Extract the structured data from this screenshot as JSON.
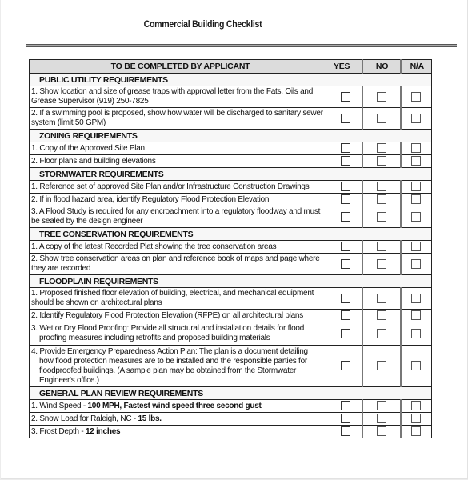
{
  "document": {
    "title": "Commercial Building Checklist"
  },
  "table": {
    "headers": {
      "description": "TO BE COMPLETED BY APPLICANT",
      "yes": "YES",
      "no": "NO",
      "na": "N/A"
    },
    "sections": [
      {
        "title": "PUBLIC UTILITY REQUIREMENTS",
        "items": [
          {
            "text": "1. Show location and size of grease traps with approval letter from the Fats, Oils and Grease Supervisor (919) 250-7825",
            "yes": false,
            "no": false,
            "na": false
          },
          {
            "text": "2. If a swimming pool is proposed, show how water will be discharged to sanitary sewer system (limit 50 GPM)",
            "yes": false,
            "no": false,
            "na": false
          }
        ]
      },
      {
        "title": "ZONING  REQUIREMENTS",
        "items": [
          {
            "text": "1. Copy of the Approved Site Plan",
            "yes": false,
            "no": false,
            "na": false
          },
          {
            "text": "2. Floor plans and building elevations",
            "yes": false,
            "no": false,
            "na": false
          }
        ]
      },
      {
        "title": "STORMWATER  REQUIREMENTS",
        "items": [
          {
            "text": "1. Reference set of approved Site Plan and/or Infrastructure Construction Drawings",
            "yes": false,
            "no": false,
            "na": false
          },
          {
            "text": "2. If in flood hazard area, identify Regulatory Flood Protection Elevation",
            "yes": false,
            "no": false,
            "na": false
          },
          {
            "text": "3. A Flood Study is required for any encroachment into a regulatory floodway and must be sealed by the design engineer",
            "yes": false,
            "no": false,
            "na": false
          }
        ]
      },
      {
        "title": "TREE CONSERVATION REQUIREMENTS",
        "items": [
          {
            "text": "1. A copy of the latest Recorded Plat showing the tree conservation areas",
            "yes": false,
            "no": false,
            "na": false
          },
          {
            "text": "2. Show tree conservation areas on plan and reference book of maps and page where they are recorded",
            "yes": false,
            "no": false,
            "na": false
          }
        ]
      },
      {
        "title": "FLOODPLAIN REQUIREMENTS",
        "items": [
          {
            "text": "1. Proposed finished floor elevation of building, electrical, and mechanical equipment should be shown on architectural plans",
            "yes": false,
            "no": false,
            "na": false
          },
          {
            "text": "2. Identify Regulatory Flood Protection Elevation (RFPE) on all architectural plans",
            "yes": false,
            "no": false,
            "na": false
          },
          {
            "text_first": "3. Wet or Dry Flood Proofing:  Provide all structural and installation details for flood",
            "text_rest": "proofing measures including retrofits and proposed building materials",
            "yes": false,
            "no": false,
            "na": false
          },
          {
            "text_first": "4. Provide Emergency Preparedness Action Plan:  The plan is a document detailing",
            "text_rest": "how flood protection measures are to be installed and the responsible parties for floodproofed buildings. (A sample plan may be obtained from the Stormwater Engineer's office.)",
            "yes": false,
            "no": false,
            "na": false
          }
        ]
      },
      {
        "title": "GENERAL PLAN REVIEW REQUIREMENTS",
        "items": [
          {
            "label": "1. Wind Speed - ",
            "value": "100 MPH, Fastest wind speed three second gust",
            "yes": false,
            "no": false,
            "na": false
          },
          {
            "label": "2. Snow Load for Raleigh, NC - ",
            "value": "15 lbs.",
            "yes": false,
            "no": false,
            "na": false
          },
          {
            "label": "3. Frost Depth - ",
            "value": "12 inches",
            "yes": false,
            "no": false,
            "na": false
          }
        ]
      }
    ]
  }
}
